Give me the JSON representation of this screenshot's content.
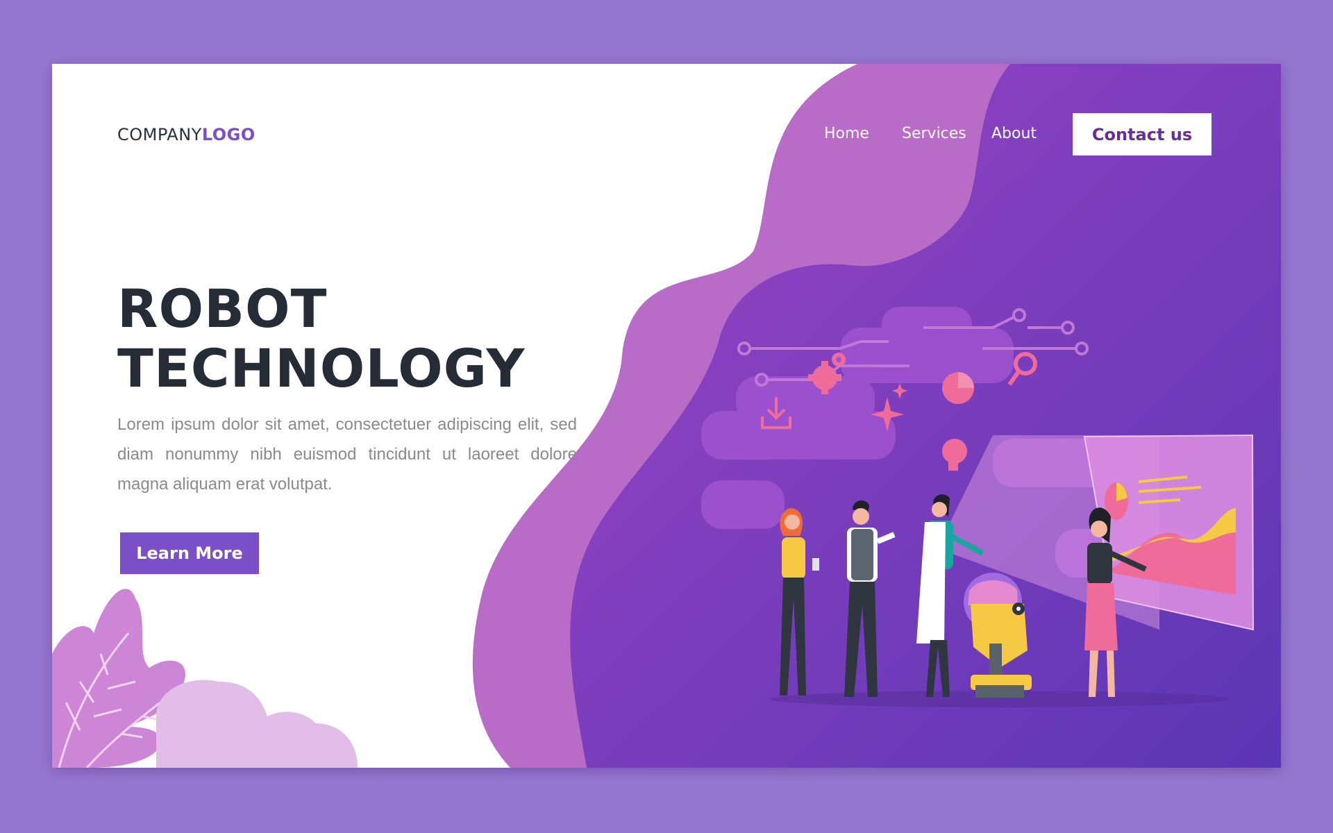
{
  "logo": {
    "regular": "COMPANY",
    "bold": "LOGO"
  },
  "nav": {
    "home": "Home",
    "services": "Services",
    "about": "About",
    "contact": "Contact us"
  },
  "hero": {
    "title_line1": "ROBOT",
    "title_line2": "TECHNOLOGY",
    "description": "Lorem ipsum dolor sit amet, consectetuer adipiscing elit, sed diam nonummy nibh euismod tincidunt ut laoreet dolore magna aliquam erat volutpat.",
    "cta": "Learn More"
  },
  "colors": {
    "page_bg": "#9677cf",
    "accent_purple": "#7b4fc8",
    "contact_text": "#6a2c9a",
    "wave_light": "#b96cc7",
    "wave_dark": "#7a3fc0",
    "robot_yellow": "#f6c945",
    "accent_pink": "#ef6b9a"
  },
  "icons": [
    "gear-icon",
    "download-icon",
    "pie-chart-icon",
    "magnifier-icon",
    "lightbulb-icon",
    "sparkle-icon"
  ]
}
